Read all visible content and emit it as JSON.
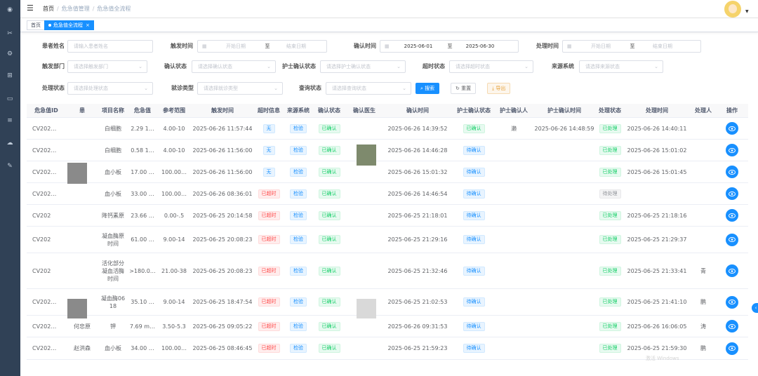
{
  "sidebar": {
    "icons": [
      "dashboard-icon",
      "tools-icon",
      "gear-icon",
      "org-icon",
      "monitor-icon",
      "database-icon",
      "cloud-icon",
      "edit-icon"
    ]
  },
  "navbar": {
    "breadcrumb": [
      "首页",
      "危急值管理",
      "危急值全流程"
    ]
  },
  "tags": {
    "home": "首页",
    "current": "危急值全流程"
  },
  "search": {
    "patient_name_label": "患者姓名",
    "patient_name_placeholder": "请输入患者姓名",
    "trigger_time_label": "触发时间",
    "start_placeholder": "开始日期",
    "to": "至",
    "end_placeholder": "结束日期",
    "confirm_time_label": "确认时间",
    "confirm_start": "2025-06-01",
    "confirm_end": "2025-06-30",
    "handle_time_label": "处理时间",
    "trigger_dept_label": "触发部门",
    "trigger_dept_placeholder": "请选择触发部门",
    "confirm_status_label": "确认状态",
    "confirm_status_placeholder": "请选择确认状态",
    "nurse_status_label": "护士确认状态",
    "nurse_status_placeholder": "请选择护士确认状态",
    "overtime_label": "超时状态",
    "overtime_placeholder": "请选择超时状态",
    "source_label": "来源系统",
    "source_placeholder": "请选择来源状态",
    "handle_status_label": "处理状态",
    "handle_status_placeholder": "请选择处理状态",
    "visit_type_label": "就诊类型",
    "visit_type_placeholder": "请选择就诊类型",
    "query_status_label": "查询状态",
    "query_status_placeholder": "请选择查询状态",
    "search_btn": "搜索",
    "reset_btn": "重置",
    "export_btn": "导出"
  },
  "table": {
    "headers": [
      "危急值ID",
      "患",
      "项目名称",
      "危急值",
      "参考范围",
      "触发时间",
      "超时信息",
      "来源系统",
      "确认状态",
      "确认医生",
      "确认时间",
      "护士确认状态",
      "护士确认人",
      "护士确认时间",
      "处理状态",
      "处理时间",
      "处理人",
      "操作"
    ],
    "rows": [
      {
        "id": "CV202…",
        "name": "",
        "item": "白细胞",
        "value": "2.29 1…",
        "range": "4.00-10",
        "trigger": "2025-06-26 11:57:44",
        "overtime": "无",
        "source": "检验",
        "confirm": "已确认",
        "doctor": "",
        "ctime": "2025-06-26 14:39:52",
        "nurse": "已确认",
        "nurse_by": "濑",
        "ntime": "2025-06-26 14:48:59",
        "handle": "已处理",
        "htime": "2025-06-26 14:40:11",
        "handler": ""
      },
      {
        "id": "CV202…",
        "name": "",
        "item": "白细胞",
        "value": "0.58 1…",
        "range": "4.00-10",
        "trigger": "2025-06-26 11:56:00",
        "overtime": "无",
        "source": "检验",
        "confirm": "已确认",
        "doctor": "",
        "ctime": "2025-06-26 14:46:28",
        "nurse": "待确认",
        "nurse_by": "",
        "ntime": "",
        "handle": "已处理",
        "htime": "2025-06-26 15:01:02",
        "handler": ""
      },
      {
        "id": "CV202…",
        "name": "",
        "item": "血小板",
        "value": "17.00 …",
        "range": "100.00…",
        "trigger": "2025-06-26 11:56:00",
        "overtime": "无",
        "source": "检验",
        "confirm": "已确认",
        "doctor": "",
        "ctime": "2025-06-26 15:01:32",
        "nurse": "待确认",
        "nurse_by": "",
        "ntime": "",
        "handle": "已处理",
        "htime": "2025-06-26 15:01:45",
        "handler": ""
      },
      {
        "id": "CV202…",
        "name": "",
        "item": "血小板",
        "value": "33.00 …",
        "range": "100.00…",
        "trigger": "2025-06-26 08:36:01",
        "overtime": "已超时",
        "source": "检验",
        "confirm": "已确认",
        "doctor": "",
        "ctime": "2025-06-26 14:46:54",
        "nurse": "待确认",
        "nurse_by": "",
        "ntime": "",
        "handle": "待处理",
        "htime": "",
        "handler": ""
      },
      {
        "id": "CV202",
        "name": "",
        "item": "降钙素原",
        "value": "23.66 …",
        "range": "0.00-.5",
        "trigger": "2025-06-25 20:14:58",
        "overtime": "已超时",
        "source": "检验",
        "confirm": "已确认",
        "doctor": "",
        "ctime": "2025-06-25 21:18:01",
        "nurse": "待确认",
        "nurse_by": "",
        "ntime": "",
        "handle": "已处理",
        "htime": "2025-06-25 21:18:16",
        "handler": ""
      },
      {
        "id": "CV202",
        "name": "",
        "item": "凝血酶原\n时间",
        "value": "61.00 …",
        "range": "9.00-14",
        "trigger": "2025-06-25 20:08:23",
        "overtime": "已超时",
        "source": "检验",
        "confirm": "已确认",
        "doctor": "",
        "ctime": "2025-06-25 21:29:16",
        "nurse": "待确认",
        "nurse_by": "",
        "ntime": "",
        "handle": "已处理",
        "htime": "2025-06-25 21:29:37",
        "handler": ""
      },
      {
        "id": "CV202",
        "name": "",
        "item": "活化部分\n凝血活酶\n时间",
        "value": ">180.0…",
        "range": "21.00-38",
        "trigger": "2025-06-25 20:08:23",
        "overtime": "已超时",
        "source": "检验",
        "confirm": "已确认",
        "doctor": "",
        "ctime": "2025-06-25 21:32:46",
        "nurse": "待确认",
        "nurse_by": "",
        "ntime": "",
        "handle": "已处理",
        "htime": "2025-06-25 21:33:41",
        "handler": "青"
      },
      {
        "id": "CV202…",
        "name": "",
        "item": "凝血酶06\n18",
        "value": "35.10 …",
        "range": "9.00-14",
        "trigger": "2025-06-25 18:47:54",
        "overtime": "已超时",
        "source": "检验",
        "confirm": "已确认",
        "doctor": "",
        "ctime": "2025-06-25 21:02:53",
        "nurse": "待确认",
        "nurse_by": "",
        "ntime": "",
        "handle": "已处理",
        "htime": "2025-06-25 21:41:10",
        "handler": "鹏"
      },
      {
        "id": "CV202…",
        "name": "何忠原",
        "item": "钾",
        "value": "7.69 m…",
        "range": "3.50-5.3",
        "trigger": "2025-06-25 09:05:22",
        "overtime": "已超时",
        "source": "检验",
        "confirm": "已确认",
        "doctor": "",
        "ctime": "2025-06-26 09:31:53",
        "nurse": "待确认",
        "nurse_by": "",
        "ntime": "",
        "handle": "已处理",
        "htime": "2025-06-26 16:06:05",
        "handler": "涛"
      },
      {
        "id": "CV202…",
        "name": "赵洪森",
        "item": "血小板",
        "value": "34.00 …",
        "range": "100.00…",
        "trigger": "2025-06-25 08:46:45",
        "overtime": "已超时",
        "source": "检验",
        "confirm": "已确认",
        "doctor": "",
        "ctime": "2025-06-25 21:59:23",
        "nurse": "待确认",
        "nurse_by": "",
        "ntime": "",
        "handle": "已处理",
        "htime": "2025-06-25 21:59:30",
        "handler": "鹏"
      }
    ]
  },
  "watermark": "激活 Windows",
  "colors": {
    "primary": "#1890ff",
    "danger": "#ff4949",
    "success": "#13ce66",
    "sidebar": "#304156"
  }
}
